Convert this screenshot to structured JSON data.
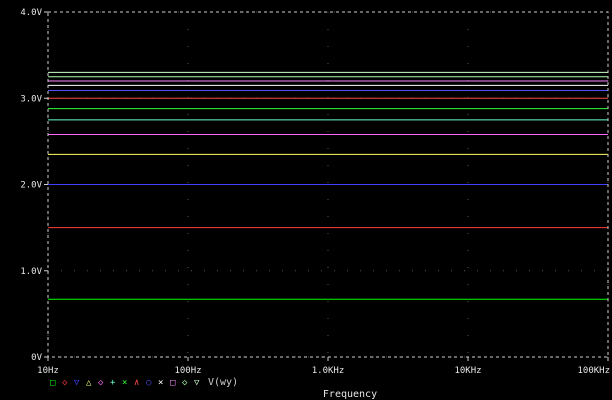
{
  "chart_data": {
    "type": "line",
    "x_scale": "log",
    "xlim": [
      10,
      100000
    ],
    "ylim": [
      0,
      4
    ],
    "x_ticks": [
      {
        "value": 10,
        "label": "10Hz"
      },
      {
        "value": 100,
        "label": "100Hz"
      },
      {
        "value": 1000,
        "label": "1.0KHz"
      },
      {
        "value": 10000,
        "label": "10KHz"
      },
      {
        "value": 100000,
        "label": "100KHz"
      }
    ],
    "y_ticks": [
      {
        "value": 0,
        "label": "0V"
      },
      {
        "value": 1,
        "label": "1.0V"
      },
      {
        "value": 2,
        "label": "2.0V"
      },
      {
        "value": 3,
        "label": "3.0V"
      },
      {
        "value": 4,
        "label": "4.0V"
      }
    ],
    "xlabel": "Frequency",
    "legend_label": "V(wy)",
    "legend_placement": "bottom-left",
    "grid": "dotted",
    "series": [
      {
        "color": "#00ff00",
        "marker": "□",
        "values": [
          0.67,
          0.67
        ]
      },
      {
        "color": "#ff3b3b",
        "marker": "◇",
        "values": [
          1.5,
          1.5
        ]
      },
      {
        "color": "#4040ff",
        "marker": "▽",
        "values": [
          2.0,
          2.0
        ]
      },
      {
        "color": "#ffff66",
        "marker": "△",
        "values": [
          2.35,
          2.35
        ]
      },
      {
        "color": "#ff66ff",
        "marker": "◇",
        "values": [
          2.58,
          2.58
        ]
      },
      {
        "color": "#66ffcc",
        "marker": "+",
        "values": [
          2.75,
          2.75
        ]
      },
      {
        "color": "#33ff33",
        "marker": "×",
        "values": [
          2.88,
          2.88
        ]
      },
      {
        "color": "#ff4444",
        "marker": "∧",
        "values": [
          3.0,
          3.0
        ]
      },
      {
        "color": "#5050ff",
        "marker": "○",
        "values": [
          3.09,
          3.09
        ]
      },
      {
        "color": "#ffffff",
        "marker": "×",
        "values": [
          3.15,
          3.15
        ]
      },
      {
        "color": "#ff88ff",
        "marker": "□",
        "values": [
          3.2,
          3.2
        ]
      },
      {
        "color": "#aaffaa",
        "marker": "◇",
        "values": [
          3.25,
          3.25
        ]
      },
      {
        "color": "#ccffcc",
        "marker": "▽",
        "values": [
          3.3,
          3.3
        ]
      }
    ],
    "x": [
      10,
      100000
    ]
  },
  "colors": {
    "background": "#000000",
    "axis": "#cfcfcf",
    "text": "#e6e6e6",
    "legend_label": "#cfcfcf"
  }
}
